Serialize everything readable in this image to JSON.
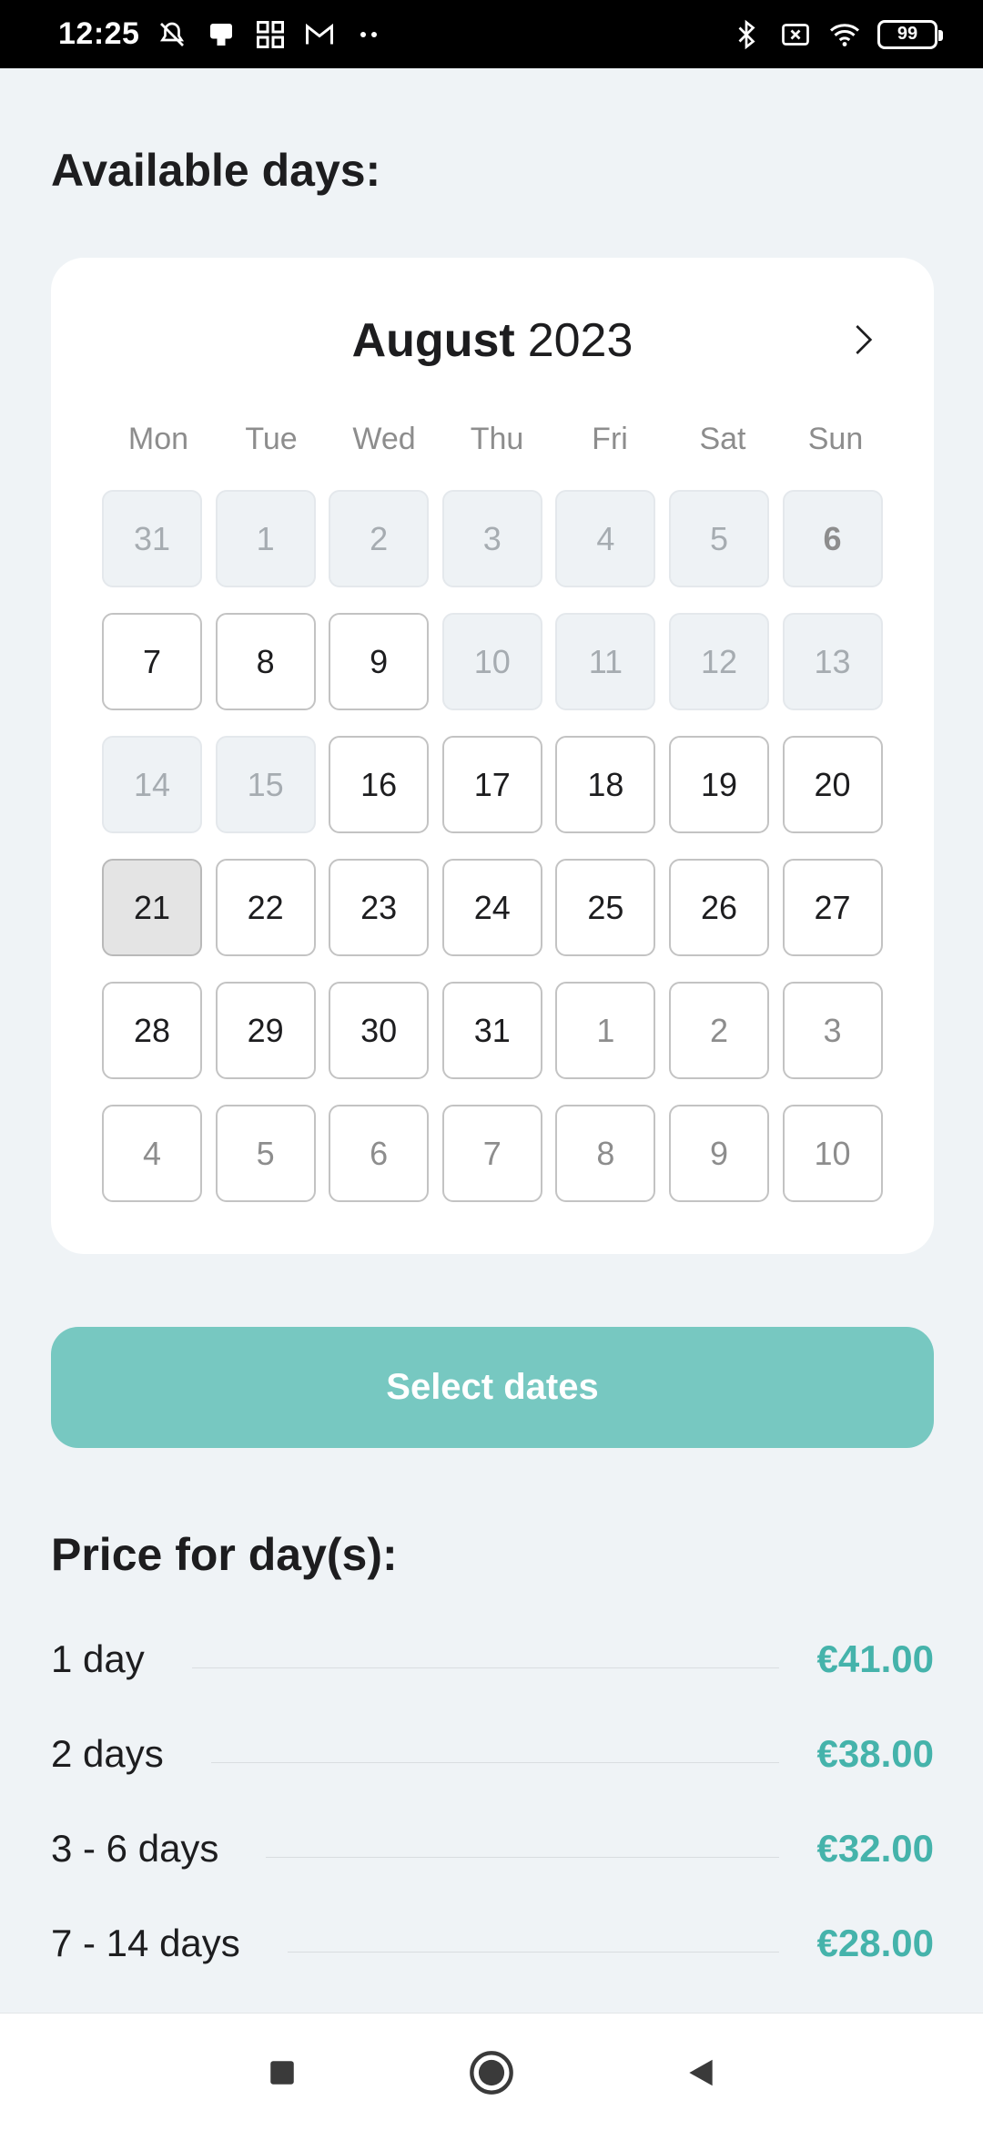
{
  "status_bar": {
    "time": "12:25",
    "battery": "99",
    "icons": [
      "mute-icon",
      "notification-icon",
      "apps-icon",
      "gmail-icon",
      "more-dots-icon",
      "bluetooth-icon",
      "sim-icon",
      "wifi-icon",
      "battery-icon"
    ]
  },
  "page": {
    "available_title": "Available days:",
    "price_title": "Price for day(s):"
  },
  "calendar": {
    "month": "August",
    "year": "2023",
    "next_icon": "chevron-right-icon",
    "weekdays": [
      "Mon",
      "Tue",
      "Wed",
      "Thu",
      "Fri",
      "Sat",
      "Sun"
    ],
    "weeks": [
      [
        {
          "d": "31",
          "s": "disabled"
        },
        {
          "d": "1",
          "s": "disabled"
        },
        {
          "d": "2",
          "s": "disabled"
        },
        {
          "d": "3",
          "s": "disabled"
        },
        {
          "d": "4",
          "s": "disabled"
        },
        {
          "d": "5",
          "s": "disabled"
        },
        {
          "d": "6",
          "s": "disabled bold"
        }
      ],
      [
        {
          "d": "7",
          "s": "available"
        },
        {
          "d": "8",
          "s": "available"
        },
        {
          "d": "9",
          "s": "available"
        },
        {
          "d": "10",
          "s": "disabled"
        },
        {
          "d": "11",
          "s": "disabled"
        },
        {
          "d": "12",
          "s": "disabled"
        },
        {
          "d": "13",
          "s": "disabled"
        }
      ],
      [
        {
          "d": "14",
          "s": "disabled"
        },
        {
          "d": "15",
          "s": "disabled"
        },
        {
          "d": "16",
          "s": "available"
        },
        {
          "d": "17",
          "s": "available"
        },
        {
          "d": "18",
          "s": "available"
        },
        {
          "d": "19",
          "s": "available"
        },
        {
          "d": "20",
          "s": "available"
        }
      ],
      [
        {
          "d": "21",
          "s": "today"
        },
        {
          "d": "22",
          "s": "available"
        },
        {
          "d": "23",
          "s": "available"
        },
        {
          "d": "24",
          "s": "available"
        },
        {
          "d": "25",
          "s": "available"
        },
        {
          "d": "26",
          "s": "available"
        },
        {
          "d": "27",
          "s": "available"
        }
      ],
      [
        {
          "d": "28",
          "s": "available"
        },
        {
          "d": "29",
          "s": "available"
        },
        {
          "d": "30",
          "s": "available"
        },
        {
          "d": "31",
          "s": "available"
        },
        {
          "d": "1",
          "s": "outside"
        },
        {
          "d": "2",
          "s": "outside"
        },
        {
          "d": "3",
          "s": "outside"
        }
      ],
      [
        {
          "d": "4",
          "s": "outside"
        },
        {
          "d": "5",
          "s": "outside"
        },
        {
          "d": "6",
          "s": "outside"
        },
        {
          "d": "7",
          "s": "outside"
        },
        {
          "d": "8",
          "s": "outside"
        },
        {
          "d": "9",
          "s": "outside"
        },
        {
          "d": "10",
          "s": "outside"
        }
      ]
    ]
  },
  "select_button": {
    "label": "Select dates"
  },
  "prices": [
    {
      "label": "1 day",
      "value": "€41.00"
    },
    {
      "label": "2 days",
      "value": "€38.00"
    },
    {
      "label": "3 - 6 days",
      "value": "€32.00"
    },
    {
      "label": "7 - 14 days",
      "value": "€28.00"
    }
  ],
  "nav_bar": {
    "icons": [
      "recent-apps-icon",
      "home-icon",
      "back-icon"
    ]
  },
  "colors": {
    "accent": "#77c8c1",
    "price": "#45b3ab",
    "background": "#eff3f6"
  }
}
